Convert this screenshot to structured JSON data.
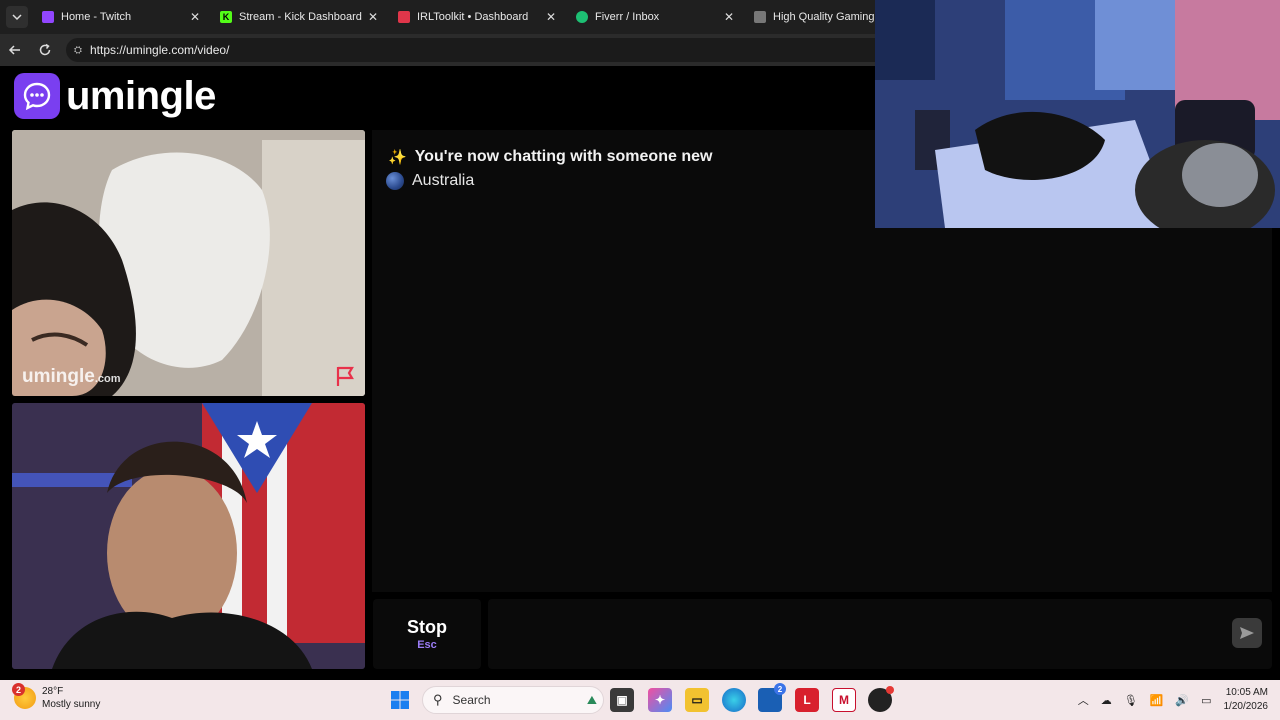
{
  "browser": {
    "tabs": [
      {
        "title": "Home - Twitch",
        "favicon": "twitch-icon",
        "color": "#9146ff"
      },
      {
        "title": "Stream - Kick Dashboard",
        "favicon": "kick-icon",
        "color": "#53fc18"
      },
      {
        "title": "IRLToolkit • Dashboard",
        "favicon": "irltoolkit-icon",
        "color": "#e0364a"
      },
      {
        "title": "Fiverr / Inbox",
        "favicon": "fiverr-icon",
        "color": "#1dbf73"
      },
      {
        "title": "High Quality Gaming Ge",
        "favicon": "page-icon",
        "color": "#777777"
      }
    ],
    "url": "https://umingle.com/video/"
  },
  "site": {
    "logo_text": "umingle",
    "brand_color": "#7a3ff0",
    "watermark": "umingle",
    "watermark_suffix": ".com"
  },
  "chat": {
    "status_message": "You're now chatting with someone new",
    "country": "Australia"
  },
  "controls": {
    "stop_label": "Stop",
    "stop_key": "Esc"
  },
  "taskbar": {
    "weather_badge": "2",
    "temperature": "28°F",
    "condition": "Mostly sunny",
    "search_label": "Search",
    "mail_badge": "2",
    "time": "10:05 AM",
    "date": "1/20/2026"
  }
}
